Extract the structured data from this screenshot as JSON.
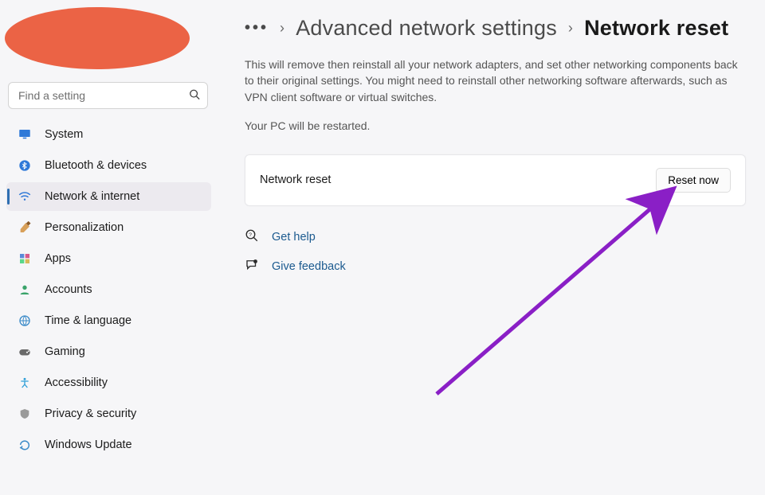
{
  "search": {
    "placeholder": "Find a setting"
  },
  "sidebar": {
    "items": [
      {
        "label": "System"
      },
      {
        "label": "Bluetooth & devices"
      },
      {
        "label": "Network & internet"
      },
      {
        "label": "Personalization"
      },
      {
        "label": "Apps"
      },
      {
        "label": "Accounts"
      },
      {
        "label": "Time & language"
      },
      {
        "label": "Gaming"
      },
      {
        "label": "Accessibility"
      },
      {
        "label": "Privacy & security"
      },
      {
        "label": "Windows Update"
      }
    ],
    "selected_index": 2
  },
  "breadcrumb": {
    "prev": "Advanced network settings",
    "current": "Network reset"
  },
  "main": {
    "description": "This will remove then reinstall all your network adapters, and set other networking components back to their original settings. You might need to reinstall other networking software afterwards, such as VPN client software or virtual switches.",
    "restart_note": "Your PC will be restarted.",
    "card_title": "Network reset",
    "reset_button": "Reset now",
    "help_label": "Get help",
    "feedback_label": "Give feedback"
  },
  "colors": {
    "accent": "#2f6fb2",
    "redact": "#eb6345",
    "arrow": "#8a1fc6"
  }
}
